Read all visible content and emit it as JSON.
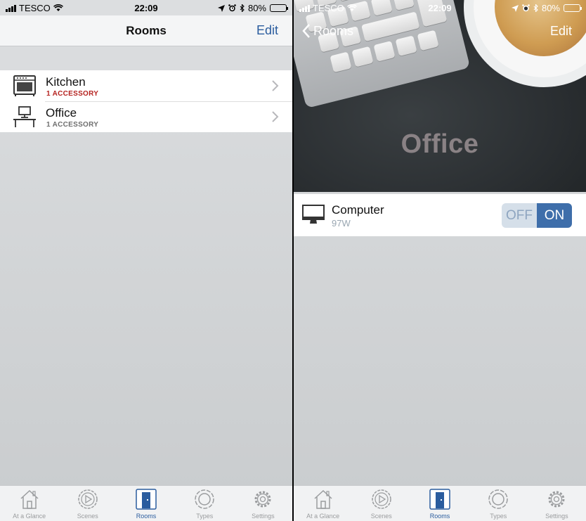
{
  "status_left": {
    "carrier": "TESCO",
    "time": "22:09",
    "battery": "80%",
    "battery_level": 0.8
  },
  "status_right": {
    "carrier": "TESCO",
    "time": "22:09",
    "battery": "80%",
    "battery_level": 0.8
  },
  "rooms_screen": {
    "title": "Rooms",
    "edit_label": "Edit",
    "rooms": [
      {
        "name": "Kitchen",
        "subtitle": "1 ACCESSORY",
        "subtitle_color": "#b5221f",
        "icon": "oven-icon"
      },
      {
        "name": "Office",
        "subtitle": "1 ACCESSORY",
        "subtitle_color": "#6e6e6e",
        "icon": "desk-computer-icon"
      }
    ]
  },
  "office_screen": {
    "back_label": "Rooms",
    "edit_label": "Edit",
    "room_title": "Office",
    "accessory": {
      "name": "Computer",
      "power": "97W",
      "icon": "monitor-icon",
      "off_label": "OFF",
      "on_label": "ON",
      "state": "on"
    }
  },
  "tabs": [
    {
      "label": "At a Glance",
      "icon": "house-icon"
    },
    {
      "label": "Scenes",
      "icon": "play-circle-icon"
    },
    {
      "label": "Rooms",
      "icon": "door-icon",
      "active": true
    },
    {
      "label": "Types",
      "icon": "ring-icon"
    },
    {
      "label": "Settings",
      "icon": "gear-icon"
    }
  ],
  "colors": {
    "accent": "#2a5c9e",
    "toggle_on": "#3e6eaa",
    "toggle_off": "#d5dfe9",
    "kitchen_subtitle": "#b5221f"
  }
}
